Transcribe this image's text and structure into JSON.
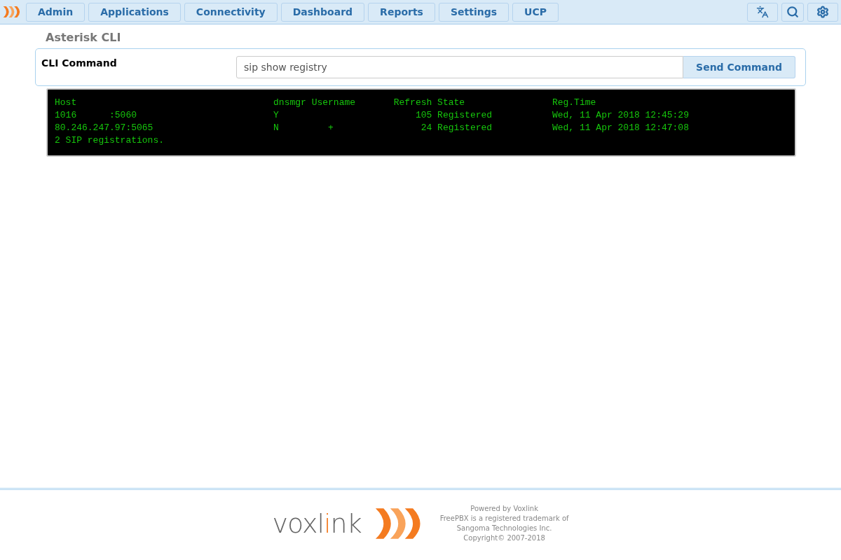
{
  "nav": {
    "items": [
      "Admin",
      "Applications",
      "Connectivity",
      "Dashboard",
      "Reports",
      "Settings",
      "UCP"
    ]
  },
  "page_title": "Asterisk CLI",
  "cli": {
    "label": "CLI Command",
    "value": "sip show registry",
    "button": "Send Command"
  },
  "output": [
    "Host                                    dnsmgr Username       Refresh State                Reg.Time",
    "1016      :5060                         Y                         105 Registered           Wed, 11 Apr 2018 12:45:29",
    "80.246.247.97:5065                      N         +                24 Registered           Wed, 11 Apr 2018 12:47:08",
    "2 SIP registrations."
  ],
  "footer": {
    "logo": [
      {
        "text": "voxl",
        "color": "#666666"
      },
      {
        "text": "i",
        "color": "#f47b20"
      },
      {
        "text": "nk",
        "color": "#666666"
      }
    ],
    "lines": [
      "Powered by Voxlink",
      "FreePBX is a registered trademark of",
      "Sangoma Technologies Inc.",
      "Copyright© 2007-2018"
    ]
  }
}
